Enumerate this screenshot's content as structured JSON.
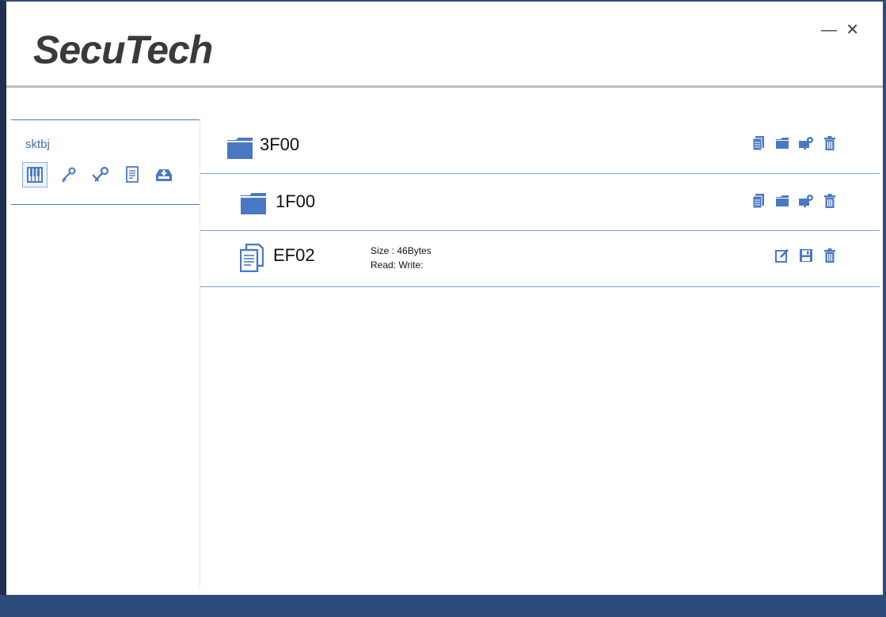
{
  "app": {
    "logo_text": "SecuTech"
  },
  "window": {
    "minimize_symbol": "—",
    "close_symbol": "✕"
  },
  "sidebar": {
    "device_name": "sktbj",
    "tools": [
      {
        "icon": "keyboard-icon",
        "active": true
      },
      {
        "icon": "key-icon"
      },
      {
        "icon": "keys-icon"
      },
      {
        "icon": "document-icon"
      },
      {
        "icon": "download-tray-icon"
      }
    ]
  },
  "tree": {
    "items": [
      {
        "name": "3F00",
        "type": "folder",
        "actions": [
          "new-file-icon",
          "new-folder-icon",
          "key-wrench-icon",
          "delete-icon"
        ]
      },
      {
        "name": "1F00",
        "type": "folder",
        "actions": [
          "new-file-icon",
          "new-folder-icon",
          "key-wrench-icon",
          "delete-icon"
        ]
      },
      {
        "name": "EF02",
        "type": "file",
        "size_text": "Size : 46Bytes",
        "perm_text": "Read:  Write:",
        "actions": [
          "edit-icon",
          "save-icon",
          "delete-icon"
        ]
      }
    ]
  },
  "colors": {
    "accent": "#4a78c4",
    "icon": "#4a78c4",
    "frame": "#2c4a7a"
  }
}
